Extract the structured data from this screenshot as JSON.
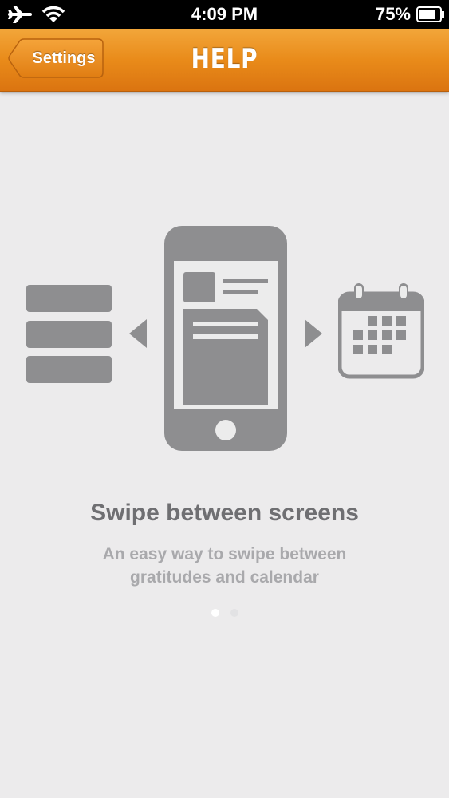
{
  "status_bar": {
    "time": "4:09 PM",
    "battery_percent": "75%",
    "icons": [
      "airplane-icon",
      "wifi-icon",
      "battery-icon"
    ]
  },
  "nav_bar": {
    "back_label": "Settings",
    "title": "HELP"
  },
  "help_page": {
    "headline": "Swipe between screens",
    "description_line1": "An easy way to swipe between",
    "description_line2": "gratitudes and calendar",
    "page_indicator": {
      "current": 1,
      "total": 2
    }
  },
  "colors": {
    "nav_orange": "#e98b1a",
    "background": "#ecebec",
    "illustration_gray": "#8e8e90",
    "headline_text": "#6f6f72",
    "description_text": "#a9a9ac"
  }
}
